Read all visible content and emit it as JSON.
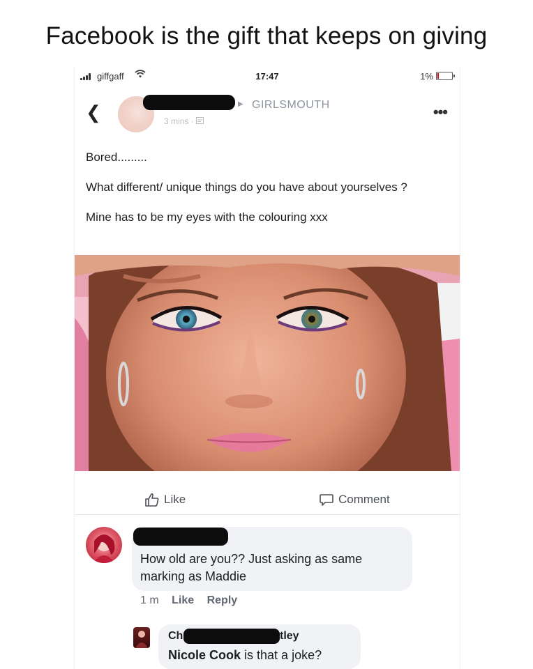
{
  "caption": "Facebook is the gift that keeps on giving",
  "status_bar": {
    "carrier": "giffgaff",
    "time": "17:47",
    "battery": "1%",
    "battery_level": 0.01
  },
  "post": {
    "group_name": "GIRLSMOUTH",
    "timestamp": "3 mins ·",
    "paragraphs": [
      "Bored.........",
      "What different/ unique things do you have about yourselves ?",
      "Mine has to be my eyes with the colouring xxx"
    ]
  },
  "actions": {
    "like": "Like",
    "comment": "Comment"
  },
  "comments": [
    {
      "text": "How old are you?? Just asking as same marking as Maddie",
      "time": "1 m",
      "like": "Like",
      "reply": "Reply"
    },
    {
      "name_start": "Ch",
      "name_end": "tley",
      "mention": "Nicole Cook",
      "text": " is that a joke?"
    }
  ],
  "colors": {
    "bubble": "#f0f2f5",
    "secondary_text": "#606770",
    "group_name": "#8d949e"
  }
}
